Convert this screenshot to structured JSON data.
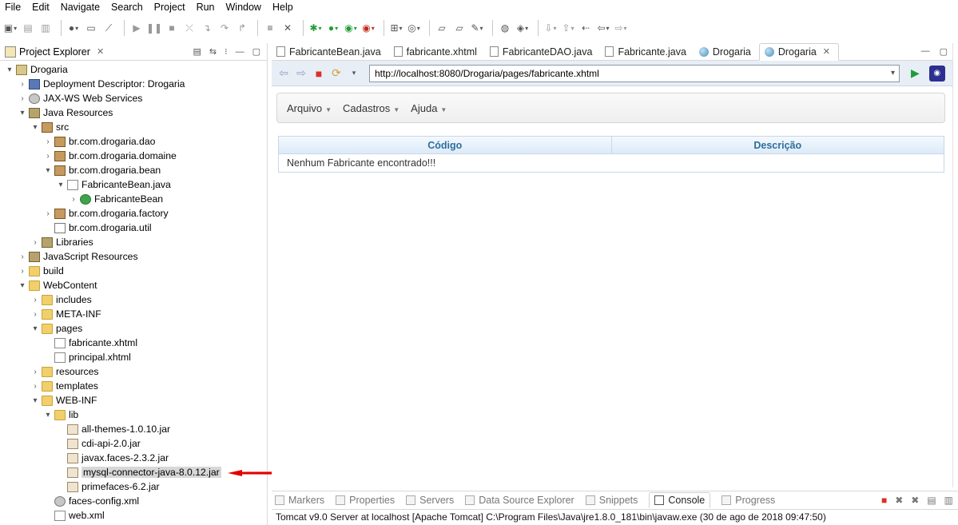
{
  "menubar": [
    "File",
    "Edit",
    "Navigate",
    "Search",
    "Project",
    "Run",
    "Window",
    "Help"
  ],
  "project_explorer": {
    "title": "Project Explorer",
    "tree": [
      {
        "label": "Drogaria",
        "depth": 0,
        "twisty": "▾",
        "icon": "project"
      },
      {
        "label": "Deployment Descriptor: Drogaria",
        "depth": 1,
        "twisty": "›",
        "icon": "desc"
      },
      {
        "label": "JAX-WS Web Services",
        "depth": 1,
        "twisty": "›",
        "icon": "gear"
      },
      {
        "label": "Java Resources",
        "depth": 1,
        "twisty": "▾",
        "icon": "lib"
      },
      {
        "label": "src",
        "depth": 2,
        "twisty": "▾",
        "icon": "package"
      },
      {
        "label": "br.com.drogaria.dao",
        "depth": 3,
        "twisty": "›",
        "icon": "package"
      },
      {
        "label": "br.com.drogaria.domaine",
        "depth": 3,
        "twisty": "›",
        "icon": "package"
      },
      {
        "label": "br.com.drogaria.bean",
        "depth": 3,
        "twisty": "▾",
        "icon": "package"
      },
      {
        "label": "FabricanteBean.java",
        "depth": 4,
        "twisty": "▾",
        "icon": "java"
      },
      {
        "label": "FabricanteBean",
        "depth": 5,
        "twisty": "›",
        "icon": "cls"
      },
      {
        "label": "br.com.drogaria.factory",
        "depth": 3,
        "twisty": "›",
        "icon": "package"
      },
      {
        "label": "br.com.drogaria.util",
        "depth": 3,
        "twisty": "",
        "icon": "pkgempty"
      },
      {
        "label": "Libraries",
        "depth": 2,
        "twisty": "›",
        "icon": "lib"
      },
      {
        "label": "JavaScript Resources",
        "depth": 1,
        "twisty": "›",
        "icon": "lib"
      },
      {
        "label": "build",
        "depth": 1,
        "twisty": "›",
        "icon": "folder"
      },
      {
        "label": "WebContent",
        "depth": 1,
        "twisty": "▾",
        "icon": "folder"
      },
      {
        "label": "includes",
        "depth": 2,
        "twisty": "›",
        "icon": "folder"
      },
      {
        "label": "META-INF",
        "depth": 2,
        "twisty": "›",
        "icon": "folder"
      },
      {
        "label": "pages",
        "depth": 2,
        "twisty": "▾",
        "icon": "folder"
      },
      {
        "label": "fabricante.xhtml",
        "depth": 3,
        "twisty": "",
        "icon": "file"
      },
      {
        "label": "principal.xhtml",
        "depth": 3,
        "twisty": "",
        "icon": "file"
      },
      {
        "label": "resources",
        "depth": 2,
        "twisty": "›",
        "icon": "folder"
      },
      {
        "label": "templates",
        "depth": 2,
        "twisty": "›",
        "icon": "folder"
      },
      {
        "label": "WEB-INF",
        "depth": 2,
        "twisty": "▾",
        "icon": "folder"
      },
      {
        "label": "lib",
        "depth": 3,
        "twisty": "▾",
        "icon": "folder"
      },
      {
        "label": "all-themes-1.0.10.jar",
        "depth": 4,
        "twisty": "",
        "icon": "jar"
      },
      {
        "label": "cdi-api-2.0.jar",
        "depth": 4,
        "twisty": "",
        "icon": "jar"
      },
      {
        "label": "javax.faces-2.3.2.jar",
        "depth": 4,
        "twisty": "",
        "icon": "jar"
      },
      {
        "label": "mysql-connector-java-8.0.12.jar",
        "depth": 4,
        "twisty": "",
        "icon": "jar",
        "selected": true
      },
      {
        "label": "primefaces-6.2.jar",
        "depth": 4,
        "twisty": "",
        "icon": "jar"
      },
      {
        "label": "faces-config.xml",
        "depth": 3,
        "twisty": "",
        "icon": "gear"
      },
      {
        "label": "web.xml",
        "depth": 3,
        "twisty": "",
        "icon": "file"
      }
    ]
  },
  "editor_tabs": [
    {
      "label": "FabricanteBean.java",
      "kind": "file"
    },
    {
      "label": "fabricante.xhtml",
      "kind": "file"
    },
    {
      "label": "FabricanteDAO.java",
      "kind": "file"
    },
    {
      "label": "Fabricante.java",
      "kind": "file"
    },
    {
      "label": "Drogaria",
      "kind": "globe"
    },
    {
      "label": "Drogaria",
      "kind": "globe",
      "active": true
    }
  ],
  "browser": {
    "url": "http://localhost:8080/Drogaria/pages/fabricante.xhtml"
  },
  "page": {
    "menu": [
      "Arquivo",
      "Cadastros",
      "Ajuda"
    ],
    "table": {
      "columns": [
        "Código",
        "Descrição"
      ],
      "empty_message": "Nenhum Fabricante encontrado!!!"
    }
  },
  "bottom_tabs": [
    {
      "label": "Markers"
    },
    {
      "label": "Properties"
    },
    {
      "label": "Servers"
    },
    {
      "label": "Data Source Explorer"
    },
    {
      "label": "Snippets"
    },
    {
      "label": "Console",
      "active": true
    },
    {
      "label": "Progress"
    }
  ],
  "console": {
    "line": "Tomcat v9.0 Server at localhost [Apache Tomcat] C:\\Program Files\\Java\\jre1.8.0_181\\bin\\javaw.exe (30 de ago de 2018 09:47:50)"
  },
  "colors": {
    "header_text": "#2e6e9e",
    "arrow": "#e30000",
    "selection": "#d7d7d7"
  }
}
